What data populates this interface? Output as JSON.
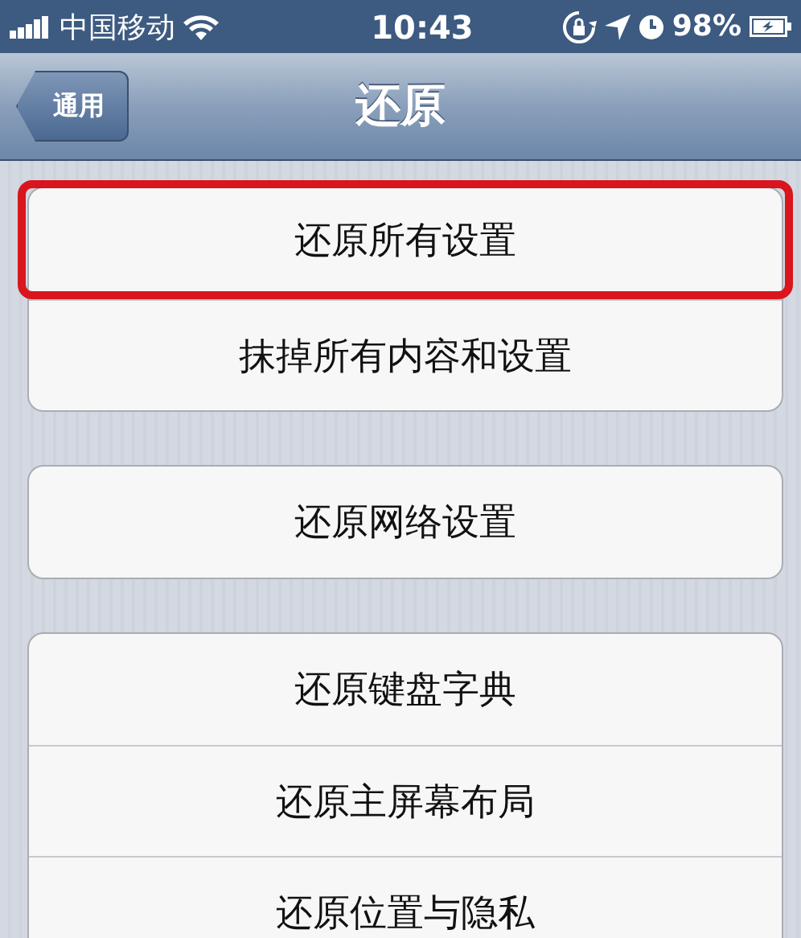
{
  "status_bar": {
    "carrier": "中国移动",
    "time": "10:43",
    "battery": "98%"
  },
  "nav_bar": {
    "title": "还原",
    "back_button": "通用"
  },
  "groups": [
    {
      "rows": [
        {
          "label": "还原所有设置",
          "highlighted": true
        },
        {
          "label": "抹掉所有内容和设置",
          "highlighted": false
        }
      ]
    },
    {
      "rows": [
        {
          "label": "还原网络设置",
          "highlighted": false
        }
      ]
    },
    {
      "rows": [
        {
          "label": "还原键盘字典",
          "highlighted": false
        },
        {
          "label": "还原主屏幕布局",
          "highlighted": false
        },
        {
          "label": "还原位置与隐私",
          "highlighted": false
        }
      ]
    }
  ]
}
